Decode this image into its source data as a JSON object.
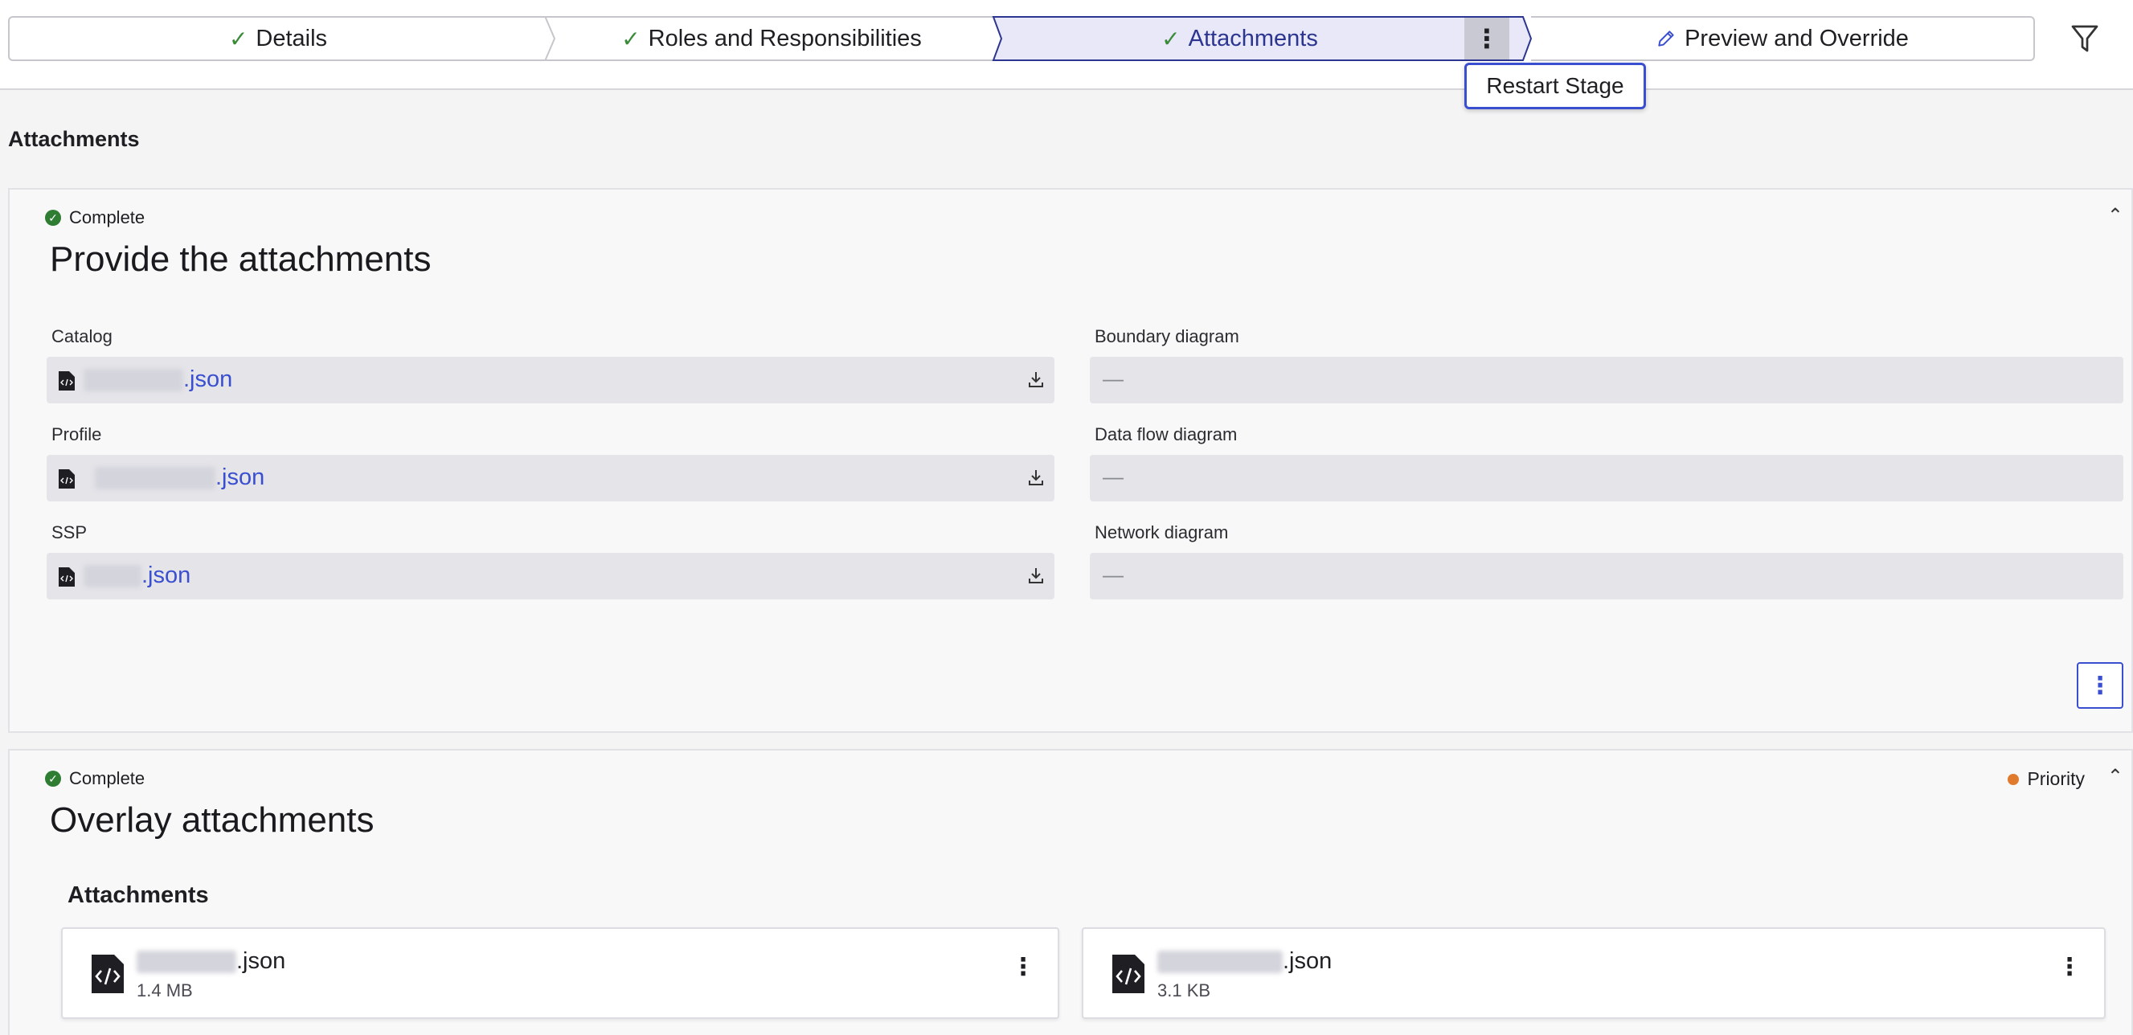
{
  "stepper": {
    "steps": [
      {
        "label": "Details",
        "state": "complete"
      },
      {
        "label": "Roles and Responsibilities",
        "state": "complete"
      },
      {
        "label": "Attachments",
        "state": "active"
      },
      {
        "label": "Preview and Override",
        "state": "edit"
      }
    ],
    "menu": {
      "restart_label": "Restart Stage"
    }
  },
  "page": {
    "heading": "Attachments"
  },
  "panel1": {
    "status": "Complete",
    "title": "Provide the attachments",
    "fields": {
      "catalog": {
        "label": "Catalog",
        "file_suffix": ".json"
      },
      "profile": {
        "label": "Profile",
        "file_suffix": ".json"
      },
      "ssp": {
        "label": "SSP",
        "file_suffix": ".json"
      },
      "boundary": {
        "label": "Boundary diagram",
        "value": "—"
      },
      "dataflow": {
        "label": "Data flow diagram",
        "value": "—"
      },
      "network": {
        "label": "Network diagram",
        "value": "—"
      }
    }
  },
  "panel2": {
    "status": "Complete",
    "priority": "Priority",
    "title": "Overlay attachments",
    "sub_heading": "Attachments",
    "cards": [
      {
        "name_suffix": ".json",
        "size": "1.4 MB"
      },
      {
        "name_suffix": ".json",
        "size": "3.1 KB"
      }
    ]
  },
  "colors": {
    "accent": "#3a4fd0",
    "active_step_bg": "#e8e8f8",
    "active_step_text": "#2c3690",
    "complete": "#2e7d32",
    "priority": "#e07b2e"
  },
  "icons": [
    "check-icon",
    "pencil-icon",
    "kebab-icon",
    "filter-icon",
    "file-code-icon",
    "download-icon",
    "chevron-up-icon",
    "status-complete-icon"
  ]
}
